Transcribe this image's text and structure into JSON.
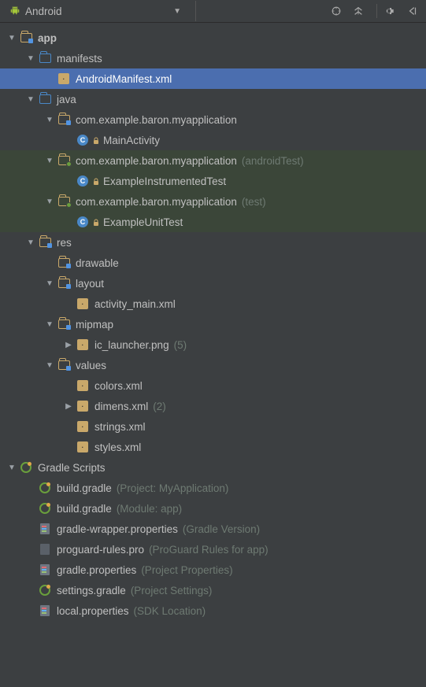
{
  "toolbar": {
    "view": "Android"
  },
  "tree": [
    {
      "d": 0,
      "arrow": "down",
      "icon": "folder-app",
      "label": "app",
      "bold": true
    },
    {
      "d": 1,
      "arrow": "down",
      "icon": "folder-blue",
      "label": "manifests"
    },
    {
      "d": 2,
      "arrow": "",
      "icon": "xml",
      "label": "AndroidManifest.xml",
      "sel": true
    },
    {
      "d": 1,
      "arrow": "down",
      "icon": "folder-blue",
      "label": "java"
    },
    {
      "d": 2,
      "arrow": "down",
      "icon": "folder-pkg",
      "label": "com.example.baron.myapplication"
    },
    {
      "d": 3,
      "arrow": "",
      "icon": "class",
      "label": "MainActivity",
      "lock": true
    },
    {
      "d": 2,
      "arrow": "down",
      "icon": "folder-pkg-g",
      "label": "com.example.baron.myapplication",
      "suffix": "(androidTest)",
      "shade": true
    },
    {
      "d": 3,
      "arrow": "",
      "icon": "class",
      "label": "ExampleInstrumentedTest",
      "lock": true,
      "shade": true
    },
    {
      "d": 2,
      "arrow": "down",
      "icon": "folder-pkg-g",
      "label": "com.example.baron.myapplication",
      "suffix": "(test)",
      "shade": true
    },
    {
      "d": 3,
      "arrow": "",
      "icon": "class",
      "label": "ExampleUnitTest",
      "lock": true,
      "shade": true
    },
    {
      "d": 1,
      "arrow": "down",
      "icon": "folder-res",
      "label": "res"
    },
    {
      "d": 2,
      "arrow": "",
      "icon": "folder-res",
      "label": "drawable"
    },
    {
      "d": 2,
      "arrow": "down",
      "icon": "folder-res",
      "label": "layout"
    },
    {
      "d": 3,
      "arrow": "",
      "icon": "xml",
      "label": "activity_main.xml"
    },
    {
      "d": 2,
      "arrow": "down",
      "icon": "folder-res",
      "label": "mipmap"
    },
    {
      "d": 3,
      "arrow": "right",
      "icon": "xml",
      "label": "ic_launcher.png",
      "suffix": "(5)"
    },
    {
      "d": 2,
      "arrow": "down",
      "icon": "folder-res",
      "label": "values"
    },
    {
      "d": 3,
      "arrow": "",
      "icon": "xml",
      "label": "colors.xml"
    },
    {
      "d": 3,
      "arrow": "right",
      "icon": "xml",
      "label": "dimens.xml",
      "suffix": "(2)"
    },
    {
      "d": 3,
      "arrow": "",
      "icon": "xml",
      "label": "strings.xml"
    },
    {
      "d": 3,
      "arrow": "",
      "icon": "xml",
      "label": "styles.xml"
    },
    {
      "d": 0,
      "arrow": "down",
      "icon": "gradle",
      "label": "Gradle Scripts"
    },
    {
      "d": 1,
      "arrow": "",
      "icon": "gradle",
      "label": "build.gradle",
      "suffix": "(Project: MyApplication)"
    },
    {
      "d": 1,
      "arrow": "",
      "icon": "gradle",
      "label": "build.gradle",
      "suffix": "(Module: app)"
    },
    {
      "d": 1,
      "arrow": "",
      "icon": "props",
      "label": "gradle-wrapper.properties",
      "suffix": "(Gradle Version)"
    },
    {
      "d": 1,
      "arrow": "",
      "icon": "pro",
      "label": "proguard-rules.pro",
      "suffix": "(ProGuard Rules for app)"
    },
    {
      "d": 1,
      "arrow": "",
      "icon": "props",
      "label": "gradle.properties",
      "suffix": "(Project Properties)"
    },
    {
      "d": 1,
      "arrow": "",
      "icon": "gradle",
      "label": "settings.gradle",
      "suffix": "(Project Settings)"
    },
    {
      "d": 1,
      "arrow": "",
      "icon": "props",
      "label": "local.properties",
      "suffix": "(SDK Location)"
    }
  ]
}
